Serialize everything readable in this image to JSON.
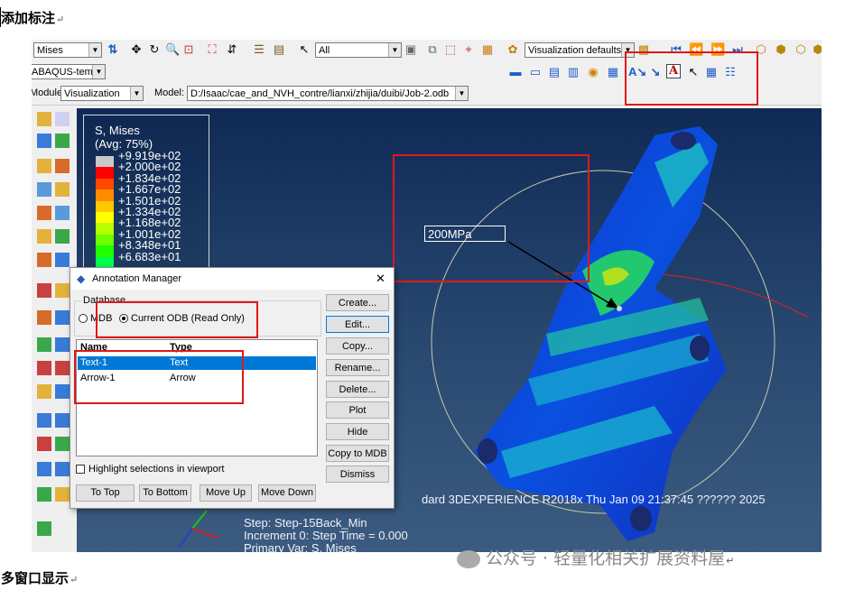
{
  "doc": {
    "heading_top": "添加标注",
    "heading_bottom": "多窗口显示",
    "paragraph_mark": "↵"
  },
  "toolbar1": {
    "field_output": "Mises",
    "selection_filter": "All",
    "visualization_defaults": "Visualization defaults"
  },
  "toolbar2": {
    "context": "ABAQUS-temp"
  },
  "toolbar3": {
    "module_label": "Module:",
    "module_value": "Visualization",
    "model_label": "Model:",
    "model_value": "D:/Isaac/cae_and_NVH_contre/lianxi/zhijia/duibi/Job-2.odb"
  },
  "legend": {
    "title1": "S, Mises",
    "title2": "(Avg: 75%)",
    "colors": [
      "#c8c8c8",
      "#ff0000",
      "#ff4a00",
      "#ff8c00",
      "#ffc800",
      "#ffff00",
      "#b8ff00",
      "#6eff00",
      "#1eff00",
      "#00ff50"
    ],
    "values": [
      "+9.919e+02",
      "+2.000e+02",
      "+1.834e+02",
      "+1.667e+02",
      "+1.501e+02",
      "+1.334e+02",
      "+1.168e+02",
      "+1.001e+02",
      "+8.348e+01",
      "+6.683e+01"
    ]
  },
  "viewport": {
    "annotation_text": "200MPa",
    "info_line": "dard 3DEXPERIENCE R2018x    Thu Jan 09 21:37:45 ?????? 2025",
    "step": "Step: Step-15Back_Min",
    "increment": "Increment     0: Step Time =    0.000",
    "primary_var": "Primary Var: S, Mises"
  },
  "dialog": {
    "title": "Annotation Manager",
    "close": "✕",
    "group_label": "Database",
    "radio_mdb": "MDB",
    "radio_odb": "Current ODB (Read Only)",
    "col_name": "Name",
    "col_type": "Type",
    "rows": [
      {
        "name": "Text-1",
        "type": "Text"
      },
      {
        "name": "Arrow-1",
        "type": "Arrow"
      }
    ],
    "buttons": [
      "Create...",
      "Edit...",
      "Copy...",
      "Rename...",
      "Delete...",
      "Plot",
      "Hide",
      "Copy to MDB",
      "Dismiss"
    ],
    "highlight_label": "Highlight selections in viewport",
    "bottom_buttons": [
      "To Top",
      "To Bottom",
      "Move Up",
      "Move Down"
    ]
  },
  "watermark": "公众号 · 轻量化相关扩展资料屋",
  "colors": {
    "highlight_red": "#e01818",
    "selection_blue": "#0078d7",
    "viewport_top": "#0f2a55"
  }
}
